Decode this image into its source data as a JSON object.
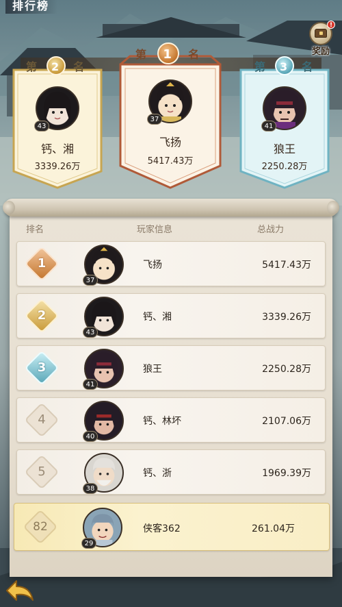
{
  "title": "排行榜",
  "reward": {
    "label": "奖励",
    "badge": "!"
  },
  "podium": [
    {
      "rank": 2,
      "tag_pre": "第",
      "tag_num": "2",
      "tag_post": "名",
      "name": "钙、湘",
      "power": "3339.26万",
      "level": "43"
    },
    {
      "rank": 1,
      "tag_pre": "第",
      "tag_num": "1",
      "tag_post": "名",
      "name": "飞扬",
      "power": "5417.43万",
      "level": "37"
    },
    {
      "rank": 3,
      "tag_pre": "第",
      "tag_num": "3",
      "tag_post": "名",
      "name": "狼王",
      "power": "2250.28万",
      "level": "41"
    }
  ],
  "table": {
    "headers": {
      "rank": "排名",
      "player": "玩家信息",
      "power": "总战力"
    },
    "rows": [
      {
        "rank": "1",
        "level": "37",
        "name": "飞扬",
        "power": "5417.43万"
      },
      {
        "rank": "2",
        "level": "43",
        "name": "钙、湘",
        "power": "3339.26万"
      },
      {
        "rank": "3",
        "level": "41",
        "name": "狼王",
        "power": "2250.28万"
      },
      {
        "rank": "4",
        "level": "40",
        "name": "钙、林坏",
        "power": "2107.06万"
      },
      {
        "rank": "5",
        "level": "38",
        "name": "钙、浙",
        "power": "1969.39万"
      }
    ],
    "me": {
      "rank": "82",
      "level": "29",
      "name": "侠客362",
      "power": "261.04万"
    }
  },
  "colors": {
    "gold": "#c99a3a",
    "silver": "#b8a57a",
    "bronze_teal": "#5aa7b8",
    "first": "#c4762e"
  },
  "icons": {
    "back": "back-arrow-icon",
    "reward": "treasure-chest-icon"
  }
}
